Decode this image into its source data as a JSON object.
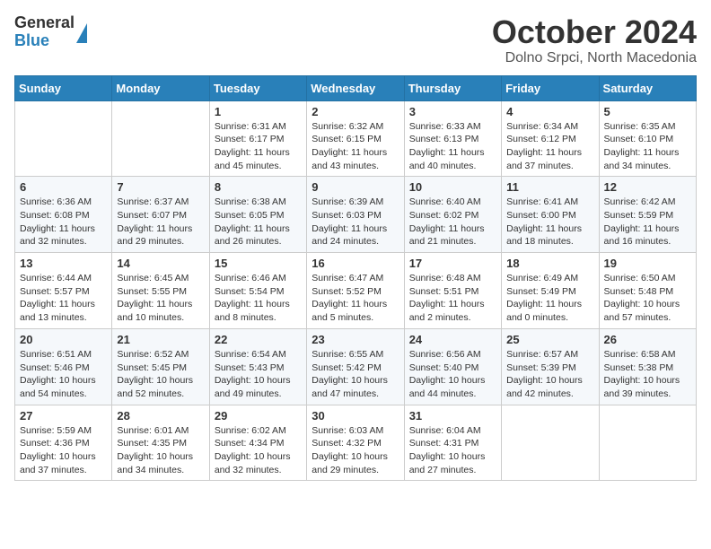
{
  "logo": {
    "general": "General",
    "blue": "Blue"
  },
  "header": {
    "month": "October 2024",
    "location": "Dolno Srpci, North Macedonia"
  },
  "days_of_week": [
    "Sunday",
    "Monday",
    "Tuesday",
    "Wednesday",
    "Thursday",
    "Friday",
    "Saturday"
  ],
  "weeks": [
    [
      {
        "day": "",
        "info": ""
      },
      {
        "day": "",
        "info": ""
      },
      {
        "day": "1",
        "info": "Sunrise: 6:31 AM\nSunset: 6:17 PM\nDaylight: 11 hours and 45 minutes."
      },
      {
        "day": "2",
        "info": "Sunrise: 6:32 AM\nSunset: 6:15 PM\nDaylight: 11 hours and 43 minutes."
      },
      {
        "day": "3",
        "info": "Sunrise: 6:33 AM\nSunset: 6:13 PM\nDaylight: 11 hours and 40 minutes."
      },
      {
        "day": "4",
        "info": "Sunrise: 6:34 AM\nSunset: 6:12 PM\nDaylight: 11 hours and 37 minutes."
      },
      {
        "day": "5",
        "info": "Sunrise: 6:35 AM\nSunset: 6:10 PM\nDaylight: 11 hours and 34 minutes."
      }
    ],
    [
      {
        "day": "6",
        "info": "Sunrise: 6:36 AM\nSunset: 6:08 PM\nDaylight: 11 hours and 32 minutes."
      },
      {
        "day": "7",
        "info": "Sunrise: 6:37 AM\nSunset: 6:07 PM\nDaylight: 11 hours and 29 minutes."
      },
      {
        "day": "8",
        "info": "Sunrise: 6:38 AM\nSunset: 6:05 PM\nDaylight: 11 hours and 26 minutes."
      },
      {
        "day": "9",
        "info": "Sunrise: 6:39 AM\nSunset: 6:03 PM\nDaylight: 11 hours and 24 minutes."
      },
      {
        "day": "10",
        "info": "Sunrise: 6:40 AM\nSunset: 6:02 PM\nDaylight: 11 hours and 21 minutes."
      },
      {
        "day": "11",
        "info": "Sunrise: 6:41 AM\nSunset: 6:00 PM\nDaylight: 11 hours and 18 minutes."
      },
      {
        "day": "12",
        "info": "Sunrise: 6:42 AM\nSunset: 5:59 PM\nDaylight: 11 hours and 16 minutes."
      }
    ],
    [
      {
        "day": "13",
        "info": "Sunrise: 6:44 AM\nSunset: 5:57 PM\nDaylight: 11 hours and 13 minutes."
      },
      {
        "day": "14",
        "info": "Sunrise: 6:45 AM\nSunset: 5:55 PM\nDaylight: 11 hours and 10 minutes."
      },
      {
        "day": "15",
        "info": "Sunrise: 6:46 AM\nSunset: 5:54 PM\nDaylight: 11 hours and 8 minutes."
      },
      {
        "day": "16",
        "info": "Sunrise: 6:47 AM\nSunset: 5:52 PM\nDaylight: 11 hours and 5 minutes."
      },
      {
        "day": "17",
        "info": "Sunrise: 6:48 AM\nSunset: 5:51 PM\nDaylight: 11 hours and 2 minutes."
      },
      {
        "day": "18",
        "info": "Sunrise: 6:49 AM\nSunset: 5:49 PM\nDaylight: 11 hours and 0 minutes."
      },
      {
        "day": "19",
        "info": "Sunrise: 6:50 AM\nSunset: 5:48 PM\nDaylight: 10 hours and 57 minutes."
      }
    ],
    [
      {
        "day": "20",
        "info": "Sunrise: 6:51 AM\nSunset: 5:46 PM\nDaylight: 10 hours and 54 minutes."
      },
      {
        "day": "21",
        "info": "Sunrise: 6:52 AM\nSunset: 5:45 PM\nDaylight: 10 hours and 52 minutes."
      },
      {
        "day": "22",
        "info": "Sunrise: 6:54 AM\nSunset: 5:43 PM\nDaylight: 10 hours and 49 minutes."
      },
      {
        "day": "23",
        "info": "Sunrise: 6:55 AM\nSunset: 5:42 PM\nDaylight: 10 hours and 47 minutes."
      },
      {
        "day": "24",
        "info": "Sunrise: 6:56 AM\nSunset: 5:40 PM\nDaylight: 10 hours and 44 minutes."
      },
      {
        "day": "25",
        "info": "Sunrise: 6:57 AM\nSunset: 5:39 PM\nDaylight: 10 hours and 42 minutes."
      },
      {
        "day": "26",
        "info": "Sunrise: 6:58 AM\nSunset: 5:38 PM\nDaylight: 10 hours and 39 minutes."
      }
    ],
    [
      {
        "day": "27",
        "info": "Sunrise: 5:59 AM\nSunset: 4:36 PM\nDaylight: 10 hours and 37 minutes."
      },
      {
        "day": "28",
        "info": "Sunrise: 6:01 AM\nSunset: 4:35 PM\nDaylight: 10 hours and 34 minutes."
      },
      {
        "day": "29",
        "info": "Sunrise: 6:02 AM\nSunset: 4:34 PM\nDaylight: 10 hours and 32 minutes."
      },
      {
        "day": "30",
        "info": "Sunrise: 6:03 AM\nSunset: 4:32 PM\nDaylight: 10 hours and 29 minutes."
      },
      {
        "day": "31",
        "info": "Sunrise: 6:04 AM\nSunset: 4:31 PM\nDaylight: 10 hours and 27 minutes."
      },
      {
        "day": "",
        "info": ""
      },
      {
        "day": "",
        "info": ""
      }
    ]
  ]
}
